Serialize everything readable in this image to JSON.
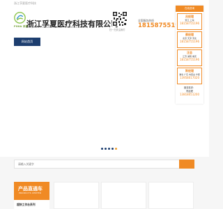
{
  "topbar": {
    "text": "浙江孚夏医疗科技"
  },
  "logo": {
    "tag": "FOXA 孚夏"
  },
  "company": {
    "name": "浙江孚夏医疗科技有限公司",
    "name_en": "ZHEJIANG FU XIA MEDICAL TECHNOLOGY CO., LTD."
  },
  "qr": {
    "label": "扫一扫关注我们"
  },
  "hotline": {
    "label": "全国服务热线",
    "number": "18158755196"
  },
  "nav": {
    "home": "网站首页"
  },
  "carousel": {
    "slides": 5,
    "active_index": 4
  },
  "side_panel": {
    "title": "在线咨询",
    "contacts": [
      {
        "name": "吕经理",
        "role": "浙江 上海",
        "phone": "18158755196"
      },
      {
        "name": "蔡经理",
        "role": "北京 天津 河北",
        "phone": "18158755196"
      },
      {
        "name": "汪总",
        "role": "江苏 湖南 重庆",
        "phone": "18158755196"
      },
      {
        "name": "陈经理",
        "role": "湖北 广东 内蒙古 宁夏",
        "phone": "13958017020"
      }
    ],
    "service_label": "服务需求：",
    "service_person": "陈经理",
    "service_phone": "13818051200"
  },
  "search": {
    "placeholder": "请输入关键字"
  },
  "products": {
    "title": "产品直通车",
    "subtitle": "PRODUCTS CENTER",
    "category": "超快工作台系列"
  },
  "colors": {
    "accent": "#f08a24",
    "navy": "#1d3e6f"
  }
}
